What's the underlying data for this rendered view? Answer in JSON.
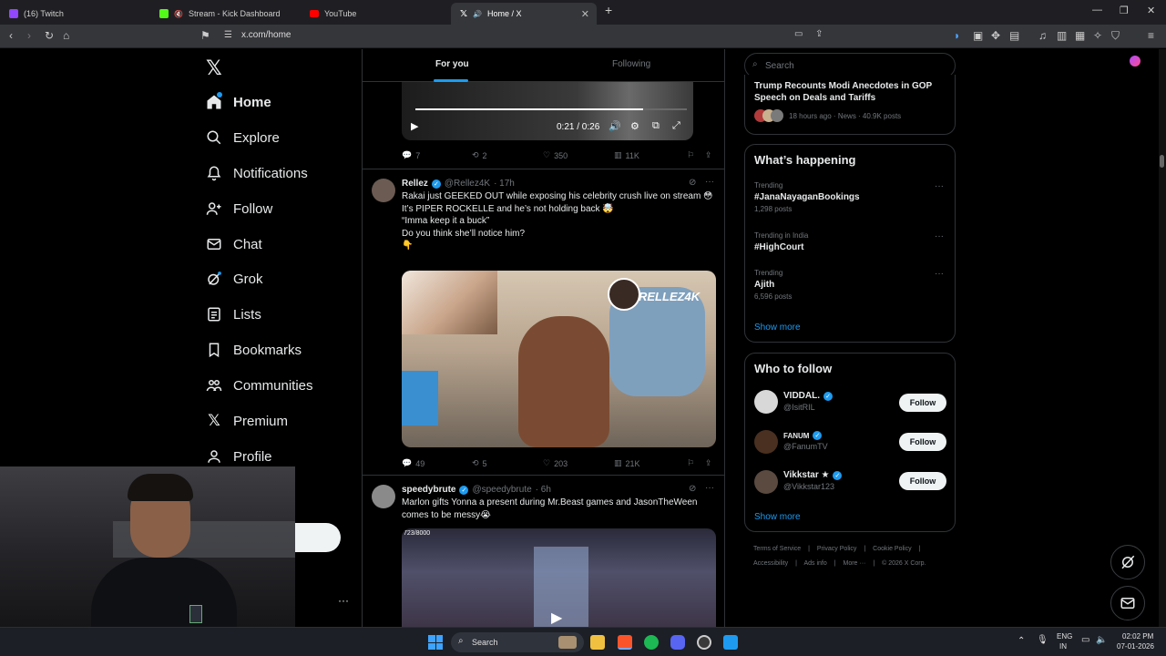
{
  "browser": {
    "tabs": [
      {
        "label": "(16) Twitch",
        "color": "#9146ff"
      },
      {
        "label": "Stream - Kick Dashboard",
        "color": "#53fc18"
      },
      {
        "label": "YouTube",
        "color": "#ff0000"
      },
      {
        "label": "Home / X",
        "color": "#ffffff"
      }
    ],
    "url": "x.com/home"
  },
  "nav": {
    "items": [
      {
        "label": "Home",
        "icon": "home-icon"
      },
      {
        "label": "Explore",
        "icon": "search-icon"
      },
      {
        "label": "Notifications",
        "icon": "bell-icon"
      },
      {
        "label": "Follow",
        "icon": "person-plus-icon"
      },
      {
        "label": "Chat",
        "icon": "mail-icon"
      },
      {
        "label": "Grok",
        "icon": "grok-icon"
      },
      {
        "label": "Lists",
        "icon": "list-icon"
      },
      {
        "label": "Bookmarks",
        "icon": "bookmark-icon"
      },
      {
        "label": "Communities",
        "icon": "people-icon"
      },
      {
        "label": "Premium",
        "icon": "x-logo-icon"
      },
      {
        "label": "Profile",
        "icon": "person-icon"
      }
    ]
  },
  "feed": {
    "tabs": [
      "For you",
      "Following"
    ],
    "video1": {
      "time": "0:21 / 0:26",
      "progress": 0.84
    },
    "post1_actions": {
      "replies": "7",
      "reposts": "2",
      "likes": "350",
      "views": "11K"
    },
    "post2": {
      "name": "Rellez",
      "handle": "@Rellez4K",
      "time": "· 17h",
      "lines": [
        "Rakai just GEEKED OUT while exposing his celebrity crush live on stream 😳",
        "It’s PIPER ROCKELLE and he’s not holding back 🤯",
        "“Imma keep it a buck”",
        "Do you think she’ll notice him?",
        "👇"
      ],
      "overlay": "RELLEZ4K",
      "actions": {
        "replies": "49",
        "reposts": "5",
        "likes": "203",
        "views": "21K"
      }
    },
    "post3": {
      "name": "speedybrute",
      "handle": "@speedybrute",
      "time": "· 6h",
      "lines": [
        "Marlon gifts Yonna a present during Mr.Beast games and JasonTheWeen comes to be messy😭"
      ],
      "media_counter": "723/8000"
    }
  },
  "right": {
    "search_placeholder": "Search",
    "news": {
      "title": "Trump Recounts Modi Anecdotes in GOP Speech on Deals and Tariffs",
      "meta": "18 hours ago · News · 40.9K posts"
    },
    "happening": {
      "title": "What’s happening",
      "trends": [
        {
          "context": "Trending",
          "name": "#JanaNayaganBookings",
          "posts": "1,298 posts"
        },
        {
          "context": "Trending in India",
          "name": "#HighCourt",
          "posts": ""
        },
        {
          "context": "Trending",
          "name": "Ajith",
          "posts": "6,596 posts"
        }
      ],
      "show_more": "Show more"
    },
    "who_to_follow": {
      "title": "Who to follow",
      "users": [
        {
          "name": "VIDDAL.",
          "handle": "@IsitRIL",
          "button": "Follow"
        },
        {
          "name": "FANUM",
          "handle": "@FanumTV",
          "button": "Follow"
        },
        {
          "name": "Vikkstar ★",
          "handle": "@Vikkstar123",
          "button": "Follow"
        }
      ],
      "show_more": "Show more"
    },
    "footer": {
      "line1": [
        "Terms of Service",
        "Privacy Policy",
        "Cookie Policy"
      ],
      "line2": [
        "Accessibility",
        "Ads info",
        "More ···",
        "© 2026 X Corp."
      ]
    }
  },
  "taskbar": {
    "search": "Search",
    "lang": [
      "ENG",
      "IN"
    ],
    "time": "02:02 PM",
    "date": "07-01-2026"
  }
}
